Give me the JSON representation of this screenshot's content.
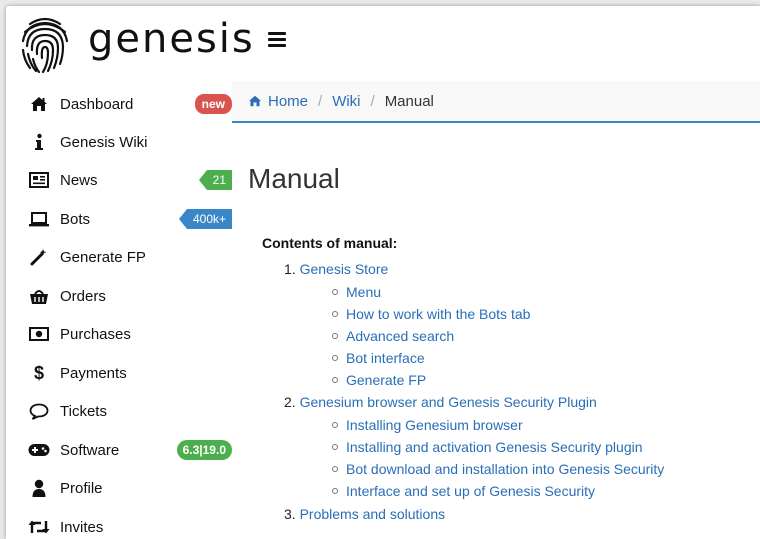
{
  "header": {
    "logo_text": "genesis"
  },
  "sidebar": {
    "items": [
      {
        "label": "Dashboard",
        "icon": "home-icon",
        "badge": "new"
      },
      {
        "label": "Genesis Wiki",
        "icon": "info-icon"
      },
      {
        "label": "News",
        "icon": "newspaper-icon",
        "badge": "21"
      },
      {
        "label": "Bots",
        "icon": "laptop-icon",
        "badge": "400k+"
      },
      {
        "label": "Generate FP",
        "icon": "magic-wand-icon"
      },
      {
        "label": "Orders",
        "icon": "basket-icon"
      },
      {
        "label": "Purchases",
        "icon": "money-icon"
      },
      {
        "label": "Payments",
        "icon": "dollar-icon"
      },
      {
        "label": "Tickets",
        "icon": "comment-icon"
      },
      {
        "label": "Software",
        "icon": "gamepad-icon",
        "badge": "6.3|19.0"
      },
      {
        "label": "Profile",
        "icon": "user-icon"
      },
      {
        "label": "Invites",
        "icon": "retweet-icon"
      }
    ]
  },
  "breadcrumb": {
    "home": "Home",
    "wiki": "Wiki",
    "current": "Manual",
    "separator": "/"
  },
  "main": {
    "title": "Manual",
    "contents_heading": "Contents of manual:",
    "toc": [
      {
        "num": "1.",
        "label": "Genesis Store",
        "children": [
          "Menu",
          "How to work with the Bots tab",
          "Advanced search",
          "Bot interface",
          "Generate FP"
        ]
      },
      {
        "num": "2.",
        "label": "Genesium browser and Genesis Security Plugin",
        "children": [
          "Installing Genesium browser",
          "Installing and activation Genesis Security plugin",
          "Bot download and installation into Genesis Security",
          "Interface and set up of Genesis Security"
        ]
      },
      {
        "num": "3.",
        "label": "Problems and solutions",
        "children": []
      }
    ]
  },
  "colors": {
    "link": "#2a6eb8",
    "accent_blue": "#3a87c8",
    "badge_red": "#d9534f",
    "badge_green": "#4cae4c"
  }
}
